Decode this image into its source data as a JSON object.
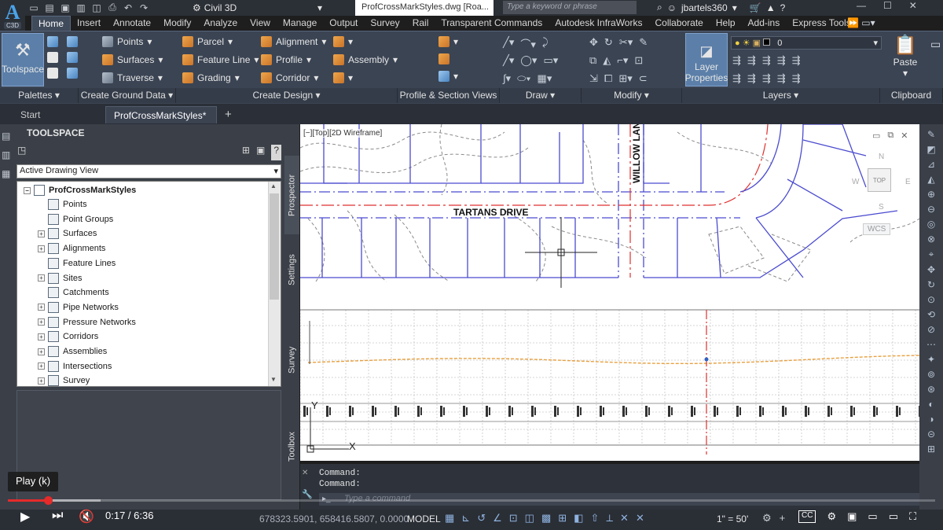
{
  "app": {
    "logo_text": "C3D",
    "workspace": "Civil 3D",
    "file_tab": "ProfCrossMarkStyles.dwg [Roa...",
    "search_placeholder": "Type a keyword or phrase",
    "user": "jbartels360"
  },
  "ribbon_tabs": [
    "Home",
    "Insert",
    "Annotate",
    "Modify",
    "Analyze",
    "View",
    "Manage",
    "Output",
    "Survey",
    "Rail",
    "Transparent Commands",
    "Autodesk InfraWorks",
    "Collaborate",
    "Help",
    "Add-ins",
    "Express Tools"
  ],
  "ribbon": {
    "toolspace": "Toolspace",
    "points": "Points",
    "surfaces": "Surfaces",
    "traverse": "Traverse",
    "parcel": "Parcel",
    "feature_line": "Feature Line",
    "grading": "Grading",
    "alignment": "Alignment",
    "profile": "Profile",
    "corridor": "Corridor",
    "assembly": "Assembly",
    "layer_properties_1": "Layer",
    "layer_properties_2": "Properties",
    "layer_current": "0",
    "paste": "Paste",
    "panels": [
      "Palettes",
      "Create Ground Data",
      "Create Design",
      "Profile & Section Views",
      "Draw",
      "Modify",
      "Layers",
      "Clipboard"
    ]
  },
  "doc_tabs": {
    "start": "Start",
    "active": "ProfCrossMarkStyles*"
  },
  "toolspace": {
    "title": "TOOLSPACE",
    "view_select": "Active Drawing View",
    "root": "ProfCrossMarkStyles",
    "items": [
      "Points",
      "Point Groups",
      "Surfaces",
      "Alignments",
      "Feature Lines",
      "Sites",
      "Catchments",
      "Pipe Networks",
      "Pressure Networks",
      "Corridors",
      "Assemblies",
      "Intersections",
      "Survey"
    ],
    "vtabs": [
      "Prospector",
      "Settings",
      "Survey",
      "Toolbox"
    ]
  },
  "viewport": {
    "label": "[−][Top][2D Wireframe]",
    "street_1": "TARTANS DRIVE",
    "street_2": "WILLOW LAN",
    "viewcube_top": "TOP",
    "compass_n": "N",
    "compass_s": "S",
    "compass_e": "E",
    "compass_w": "W",
    "ucs": "WCS",
    "axis_y": "Y",
    "axis_x": "X"
  },
  "command": {
    "line_1": "Command:",
    "line_2": "Command:",
    "placeholder": "Type a command"
  },
  "status": {
    "coords": "678323.5901, 658416.5807, 0.0000",
    "model": "MODEL",
    "scale": "1\" = 50'"
  },
  "video": {
    "tooltip": "Play (k)",
    "time": "0:17 / 6:36",
    "progress_fraction": 0.043,
    "buffered_fraction": 0.1
  },
  "colors": {
    "accent": "#4aa3e8",
    "lot_lines": "#4b4bd0",
    "centerline": "#e03030",
    "profile_line": "#e8a040",
    "progress": "#e52a2a"
  }
}
